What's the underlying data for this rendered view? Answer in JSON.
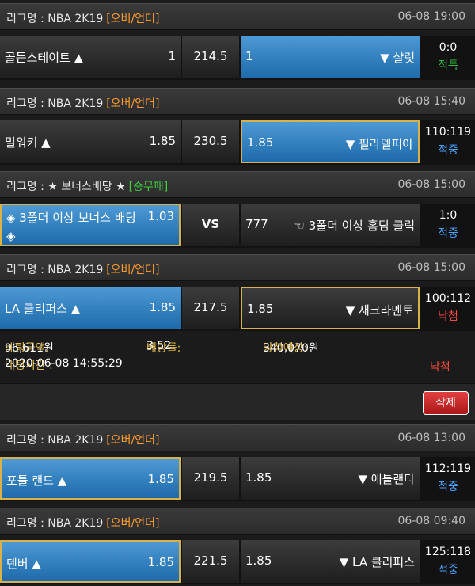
{
  "blocks": [
    {
      "league": {
        "name": "리그명 : NBA 2K19",
        "type": "[오버/언더]",
        "date": "06-08 19:00"
      },
      "home": {
        "name": "골든스테이트 ▲",
        "odds": "1"
      },
      "mid": "214.5",
      "away": {
        "odds": "1",
        "name": "▼ 샬럿"
      },
      "score": "0:0",
      "status": "적특"
    },
    {
      "league": {
        "name": "리그명 : NBA 2K19",
        "type": "[오버/언더]",
        "date": "06-08 15:40"
      },
      "home": {
        "name": "밀워키 ▲",
        "odds": "1.85"
      },
      "mid": "230.5",
      "away": {
        "odds": "1.85",
        "name": "▼ 필라델피아"
      },
      "score": "110:119",
      "status": "적중"
    },
    {
      "league": {
        "name": "리그명 : ★ 보너스배당 ★",
        "type": "[승무패]",
        "date": "06-08 15:00"
      },
      "home": {
        "name": "◈ 3폴더 이상 보너스 배당",
        "name2": "◈",
        "odds": "1.03"
      },
      "mid": "VS",
      "away": {
        "odds": "777",
        "name": "☜ 3폴더 이상 홈팀 클릭"
      },
      "score": "1:0",
      "status": "적중"
    },
    {
      "league": {
        "name": "리그명 : NBA 2K19",
        "type": "[오버/언더]",
        "date": "06-08 15:00"
      },
      "home": {
        "name": "LA 클리퍼스 ▲",
        "odds": "1.85"
      },
      "mid": "217.5",
      "away": {
        "odds": "1.85",
        "name": "▼ 새크라멘토"
      },
      "score": "100:112",
      "status": "낙첨"
    }
  ],
  "bet_info": {
    "amount_label": "베팅금액:",
    "amount": "96,611원",
    "rate_label": "배당률:",
    "rate": "3.52",
    "expected_label": "당첨예상:",
    "expected": "340,070원",
    "time_label": "배팅시간 :",
    "time": "2020-06-08 14:55:29",
    "result": "낙첨"
  },
  "delete_label": "삭제",
  "blocks2": [
    {
      "league": {
        "name": "리그명 : NBA 2K19",
        "type": "[오버/언더]",
        "date": "06-08 13:00"
      },
      "home": {
        "name": "포틀 랜드 ▲",
        "odds": "1.85"
      },
      "mid": "219.5",
      "away": {
        "odds": "1.85",
        "name": "▼ 애틀랜타"
      },
      "score": "112:119",
      "status": "적중"
    },
    {
      "league": {
        "name": "리그명 : NBA 2K19",
        "type": "[오버/언더]",
        "date": "06-08 09:40"
      },
      "home": {
        "name": "덴버 ▲",
        "odds": "1.85"
      },
      "mid": "221.5",
      "away": {
        "odds": "1.85",
        "name": "▼ LA 클리퍼스"
      },
      "score": "125:118",
      "status": "적중"
    }
  ],
  "colors": {
    "win": "#4aa3ff",
    "lose": "#ff4a3d",
    "void": "#2fbf3f",
    "selected": "#2f7fc2",
    "highlight_border": "#d7b14a"
  }
}
